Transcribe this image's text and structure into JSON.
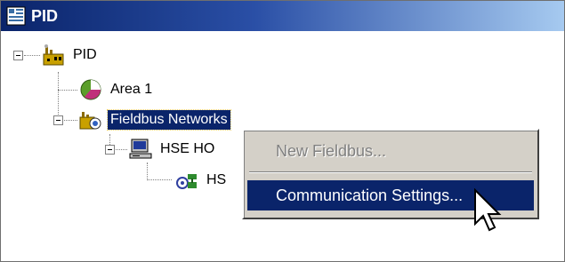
{
  "window": {
    "title": "PID",
    "title_icon": "project-icon"
  },
  "tree": {
    "root": {
      "label": "PID",
      "icon": "plant-icon"
    },
    "area": {
      "label": "Area 1",
      "icon": "area-pie-icon"
    },
    "fieldbus": {
      "label": "Fieldbus Networks",
      "icon": "fieldbus-network-icon"
    },
    "hse_host": {
      "label": "HSE HO",
      "icon": "computer-icon"
    },
    "hse_child": {
      "label": "HS",
      "icon": "network-device-icon"
    }
  },
  "context_menu": {
    "items": [
      {
        "label": "New Fieldbus...",
        "enabled": false
      },
      {
        "label": "Communication Settings...",
        "enabled": true,
        "highlighted": true
      }
    ]
  },
  "colors": {
    "selection": "#0a246a",
    "menu_bg": "#d4d0c8",
    "title_start": "#0a246a"
  }
}
